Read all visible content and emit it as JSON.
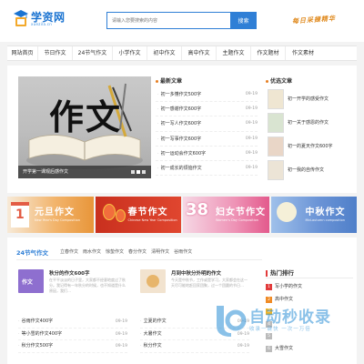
{
  "header": {
    "logo_text": "学资网",
    "logo_sub": "xuezila.cn",
    "search_placeholder": "请输入您要搜索的内容",
    "search_button": "搜索",
    "slogan": "每日采撷精华"
  },
  "nav": {
    "items": [
      "网站首页",
      "节日作文",
      "24节气作文",
      "小学作文",
      "初中作文",
      "高中作文",
      "主题作文",
      "作文题材",
      "作文素材"
    ]
  },
  "hero": {
    "image_text": "作文",
    "caption": "开学第一课观后感作文",
    "latest_title": "最新文章",
    "latest": [
      {
        "title": "初一多懂作文500字",
        "date": "09-19"
      },
      {
        "title": "初一感谢作文600字",
        "date": "09-19"
      },
      {
        "title": "初一写人作文600字",
        "date": "09-19"
      },
      {
        "title": "初一写事作文600字",
        "date": "09-19"
      },
      {
        "title": "初一运动会作文600字",
        "date": "09-19"
      },
      {
        "title": "初一成长的烦恼作文",
        "date": "09-19"
      }
    ],
    "picks_title": "优选文章",
    "picks": [
      "初一开学的感受作文",
      "初一关于感恩的作文",
      "初一的夏天作文600字",
      "初一我的自传作文"
    ]
  },
  "banners": [
    {
      "title": "元旦作文",
      "sub": "New Year's Day Composition",
      "color": "#e8963a"
    },
    {
      "title": "春节作文",
      "sub": "Chinese New Year Composition",
      "color": "#e0462f"
    },
    {
      "title": "妇女节作文",
      "sub": "Women's Day Composition",
      "color": "#e35a8c"
    },
    {
      "title": "中秋作文",
      "sub": "Mid-autumn composition",
      "color": "#4f7fc9"
    }
  ],
  "section": {
    "title": "24节气作文",
    "tabs": [
      "立春作文",
      "雨水作文",
      "惊蛰作文",
      "春分作文",
      "清明作文",
      "谷雨作文"
    ],
    "cards": [
      {
        "title": "秋分的作文600字",
        "desc": "在平平淡淡的日子里，大家都不经意地度过了秋分。我记得有一年秋分的时候，也不知道是什么原因，我们…",
        "thumb_color": "#8e6fcf",
        "thumb_text": "作文"
      },
      {
        "title": "月到中秋分外明的作文",
        "desc": "今天是中秋节，工作或是学习，大家都会在这一天尽可能地赶回家团聚，过一个团圆的节日…",
        "thumb_color": "#f2e3cf",
        "thumb_text": ""
      }
    ],
    "list_left": [
      {
        "title": "谷雨作文400字",
        "date": "09-19"
      },
      {
        "title": "等小雪的作文400字",
        "date": "09-19"
      },
      {
        "title": "秋分作文500字",
        "date": "09-19"
      }
    ],
    "list_right": [
      {
        "title": "立夏的作文",
        "date": "09-19"
      },
      {
        "title": "大暑作文",
        "date": "09-19"
      },
      {
        "title": "秋分作文",
        "date": "09-19"
      }
    ]
  },
  "hot": {
    "title": "热门排行",
    "items": [
      "写小学的作文",
      "高中作文",
      "",
      "",
      "",
      "大雪作文"
    ]
  },
  "watermark": {
    "main": "自动秒收录",
    "sub": "收录一键快 一次一万倍"
  }
}
